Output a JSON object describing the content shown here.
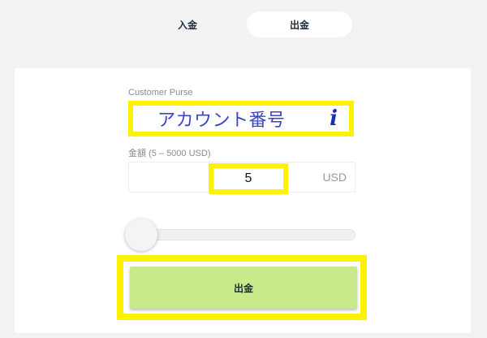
{
  "tabs": [
    {
      "label": "入金",
      "active": false
    },
    {
      "label": "出金",
      "active": true
    }
  ],
  "form": {
    "purse_label": "Customer Purse",
    "purse_value": "アカウント番号",
    "info_icon_glyph": "i",
    "amount_label": "金額 (5 – 5000 USD)",
    "amount_value": "5",
    "currency": "USD",
    "slider_fraction": 0,
    "submit_label": "出金"
  },
  "colors": {
    "highlight": "#fff200",
    "accent_button": "#c8ea8b",
    "purse_text": "#3a45c8",
    "background": "#f2f2f2"
  },
  "icons": {
    "info": "info-icon"
  }
}
